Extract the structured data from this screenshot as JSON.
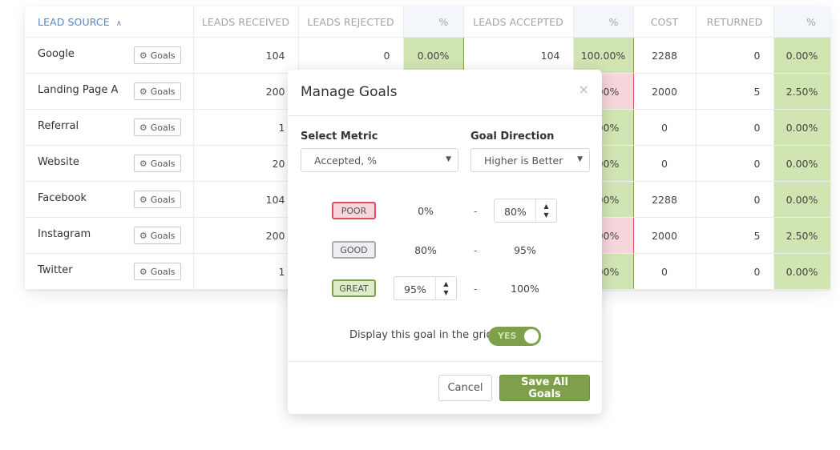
{
  "grid": {
    "columns": [
      {
        "key": "source",
        "label": "Lead Source",
        "sort": "ascending"
      },
      {
        "key": "received",
        "label": "Leads Received"
      },
      {
        "key": "rejected",
        "label": "Leads Rejected"
      },
      {
        "key": "rejected_pct",
        "label": "%"
      },
      {
        "key": "accepted",
        "label": "Leads Accepted"
      },
      {
        "key": "accepted_pct",
        "label": "%"
      },
      {
        "key": "cost",
        "label": "Cost"
      },
      {
        "key": "returned",
        "label": "Returned"
      },
      {
        "key": "returned_pct",
        "label": "%"
      }
    ],
    "sort_icon": "chevron-up-icon",
    "goals_button_label": "Goals",
    "goals_icon": "gear-icon",
    "rows": [
      {
        "source": "Google",
        "received": "104",
        "rejected": "0",
        "rejected_pct": "0.00%",
        "accepted": "104",
        "accepted_pct": "100.00%",
        "accepted_status": "good",
        "cost": "2288",
        "returned": "0",
        "returned_pct": "0.00%"
      },
      {
        "source": "Landing Page A",
        "received": "200",
        "rejected": "",
        "rejected_pct": "",
        "accepted": "",
        "accepted_pct": "0.00%",
        "accepted_status": "bad",
        "cost": "2000",
        "returned": "5",
        "returned_pct": "2.50%"
      },
      {
        "source": "Referral",
        "received": "1",
        "rejected": "",
        "rejected_pct": "",
        "accepted": "",
        "accepted_pct": "0.00%",
        "accepted_status": "good",
        "cost": "0",
        "returned": "0",
        "returned_pct": "0.00%"
      },
      {
        "source": "Website",
        "received": "20",
        "rejected": "",
        "rejected_pct": "",
        "accepted": "",
        "accepted_pct": "0.00%",
        "accepted_status": "good",
        "cost": "0",
        "returned": "0",
        "returned_pct": "0.00%"
      },
      {
        "source": "Facebook",
        "received": "104",
        "rejected": "",
        "rejected_pct": "",
        "accepted": "",
        "accepted_pct": "0.00%",
        "accepted_status": "good",
        "cost": "2288",
        "returned": "0",
        "returned_pct": "0.00%"
      },
      {
        "source": "Instagram",
        "received": "200",
        "rejected": "",
        "rejected_pct": "",
        "accepted": "",
        "accepted_pct": "0.00%",
        "accepted_status": "bad",
        "cost": "2000",
        "returned": "5",
        "returned_pct": "2.50%"
      },
      {
        "source": "Twitter",
        "received": "1",
        "rejected": "",
        "rejected_pct": "",
        "accepted": "",
        "accepted_pct": "0.00%",
        "accepted_status": "good",
        "cost": "0",
        "returned": "0",
        "returned_pct": "0.00%"
      }
    ]
  },
  "modal": {
    "title": "Manage Goals",
    "close_icon": "×",
    "metric_label": "Select Metric",
    "metric_value": "Accepted, %",
    "direction_label": "Goal Direction",
    "direction_value": "Higher is Better",
    "dropdown_icon": "▼",
    "tiers": [
      {
        "name": "Poor",
        "from": "0%",
        "to": "80%",
        "editable": "to"
      },
      {
        "name": "Good",
        "from": "80%",
        "to": "95%",
        "editable": "none"
      },
      {
        "name": "Great",
        "from": "95%",
        "to": "100%",
        "editable": "from"
      }
    ],
    "range_separator": "-",
    "stepper_up": "▲",
    "stepper_down": "▼",
    "display_label": "Display this goal in the grid",
    "display_toggle": "YES",
    "display_enabled": true,
    "cancel_label": "Cancel",
    "save_label": "Save All Goals"
  },
  "colors": {
    "good_fill": "#d1e5b3",
    "good_border": "#7ea04d",
    "bad_fill": "#f7d6db",
    "bad_border": "#d9505f",
    "accent_green": "#7ea04d",
    "header_blue": "#5b86bf"
  }
}
